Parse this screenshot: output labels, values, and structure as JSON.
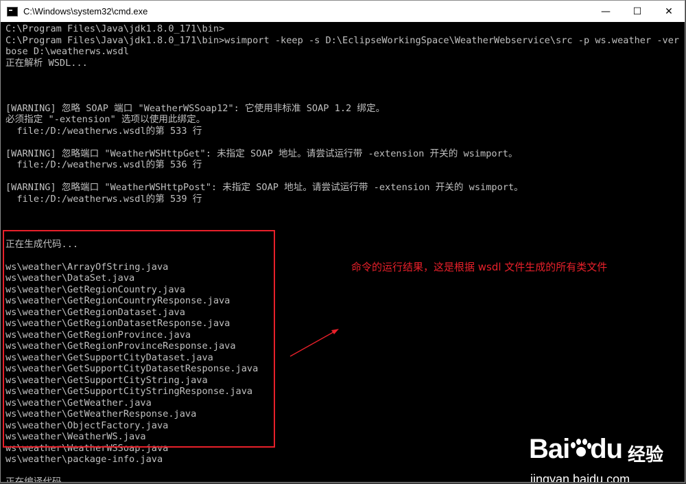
{
  "window": {
    "title": "C:\\Windows\\system32\\cmd.exe",
    "minimize": "—",
    "maximize": "☐",
    "close": "✕"
  },
  "console": {
    "lines": [
      "C:\\Program Files\\Java\\jdk1.8.0_171\\bin>",
      "C:\\Program Files\\Java\\jdk1.8.0_171\\bin>wsimport -keep -s D:\\EclipseWorkingSpace\\WeatherWebservice\\src -p ws.weather -ver",
      "bose D:\\weatherws.wsdl",
      "正在解析 WSDL...",
      "",
      "",
      "",
      "[WARNING] 忽略 SOAP 端口 \"WeatherWSSoap12\": 它使用非标准 SOAP 1.2 绑定。",
      "必须指定 \"-extension\" 选项以使用此绑定。",
      "  file:/D:/weatherws.wsdl的第 533 行",
      "",
      "[WARNING] 忽略端口 \"WeatherWSHttpGet\": 未指定 SOAP 地址。请尝试运行带 -extension 开关的 wsimport。",
      "  file:/D:/weatherws.wsdl的第 536 行",
      "",
      "[WARNING] 忽略端口 \"WeatherWSHttpPost\": 未指定 SOAP 地址。请尝试运行带 -extension 开关的 wsimport。",
      "  file:/D:/weatherws.wsdl的第 539 行",
      "",
      "",
      "",
      "正在生成代码...",
      "",
      "ws\\weather\\ArrayOfString.java",
      "ws\\weather\\DataSet.java",
      "ws\\weather\\GetRegionCountry.java",
      "ws\\weather\\GetRegionCountryResponse.java",
      "ws\\weather\\GetRegionDataset.java",
      "ws\\weather\\GetRegionDatasetResponse.java",
      "ws\\weather\\GetRegionProvince.java",
      "ws\\weather\\GetRegionProvinceResponse.java",
      "ws\\weather\\GetSupportCityDataset.java",
      "ws\\weather\\GetSupportCityDatasetResponse.java",
      "ws\\weather\\GetSupportCityString.java",
      "ws\\weather\\GetSupportCityStringResponse.java",
      "ws\\weather\\GetWeather.java",
      "ws\\weather\\GetWeatherResponse.java",
      "ws\\weather\\ObjectFactory.java",
      "ws\\weather\\WeatherWS.java",
      "ws\\weather\\WeatherWSSoap.java",
      "ws\\weather\\package-info.java",
      "",
      "正在编译代码..."
    ]
  },
  "annotation": {
    "text": "命令的运行结果，这是根据 wsdl 文件生成的所有类文件"
  },
  "watermark": {
    "brand": "Bai",
    "brand2": "du",
    "jingyan": "经验",
    "url": "jingyan.baidu.com"
  },
  "colors": {
    "console_bg": "#000000",
    "console_text": "#c0c0c0",
    "annotation_red": "#e8202a",
    "titlebar_bg": "#ffffff"
  }
}
